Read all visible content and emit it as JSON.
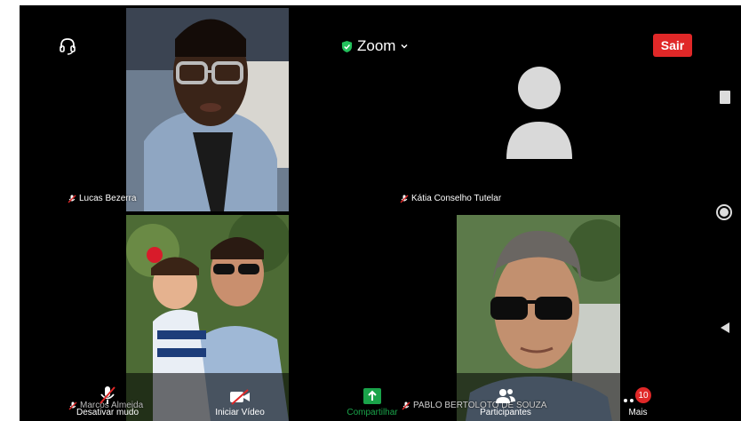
{
  "topbar": {
    "app_name": "Zoom",
    "leave_label": "Sair"
  },
  "participants": [
    {
      "name": "Lucas Bezerra",
      "muted": true
    },
    {
      "name": "Kátia Conselho Tutelar",
      "muted": true
    },
    {
      "name": "Marcos Almeida",
      "muted": true
    },
    {
      "name": "PABLO BERTOLOTO DE SOUZA",
      "muted": true
    }
  ],
  "controls": {
    "mute_label": "Desativar mudo",
    "video_label": "Iniciar Vídeo",
    "share_label": "Compartilhar",
    "participants_label": "Participantes",
    "more_label": "Mais",
    "more_badge": "10"
  },
  "colors": {
    "leave_button": "#e02828",
    "shield": "#23c15c",
    "share_icon": "#1aa34a",
    "badge": "#e02828"
  },
  "icons": {
    "audio": "headset-icon",
    "security": "shield-check-icon",
    "menu": "chevron-down-icon",
    "mute": "microphone-slash-icon",
    "video": "camera-slash-icon",
    "share": "share-arrow-icon",
    "participants": "people-icon",
    "more": "more-dots-icon"
  }
}
